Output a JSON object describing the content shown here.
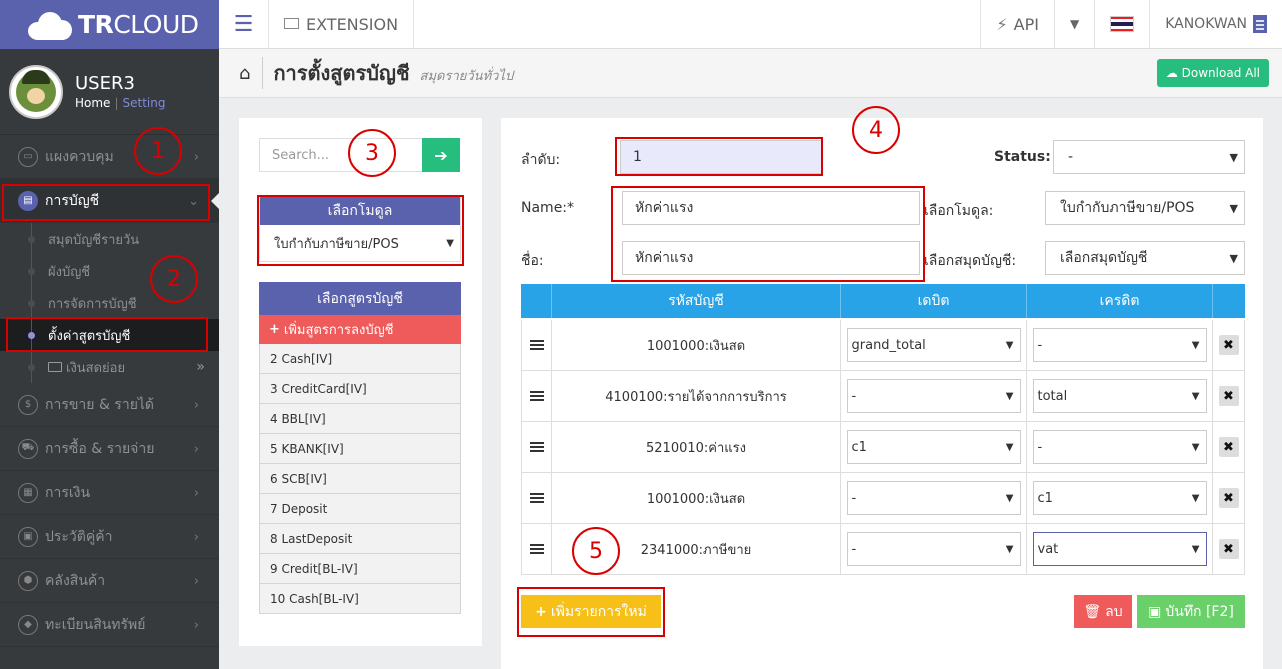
{
  "brand": {
    "tr": "TR",
    "cloud": "CLOUD"
  },
  "user": {
    "name": "USER3",
    "home_link": "Home",
    "separator": "|",
    "setting_link": "Setting"
  },
  "sidebar": {
    "items": [
      {
        "label": "แผงควบคุม",
        "icon": "monitor-icon",
        "glyph": "▭"
      },
      {
        "label": "การบัญชี",
        "icon": "book-icon",
        "glyph": "▤",
        "active": true
      },
      {
        "label": "การขาย & รายได้",
        "icon": "dollar-icon",
        "glyph": "$"
      },
      {
        "label": "การซื้อ & รายจ่าย",
        "icon": "cart-icon",
        "glyph": "⛟"
      },
      {
        "label": "การเงิน",
        "icon": "calendar-icon",
        "glyph": "▦"
      },
      {
        "label": "ประวัติคู่ค้า",
        "icon": "contact-icon",
        "glyph": "▣"
      },
      {
        "label": "คลังสินค้า",
        "icon": "cubes-icon",
        "glyph": "⬢"
      },
      {
        "label": "ทะเบียนสินทรัพย์",
        "icon": "diamond-icon",
        "glyph": "◆"
      }
    ],
    "subitems": [
      {
        "label": "สมุดบัญชีรายวัน"
      },
      {
        "label": "ผังบัญชี"
      },
      {
        "label": "การจัดการบัญชี"
      },
      {
        "label": "ตั้งค่าสูตรบัญชี",
        "active": true
      },
      {
        "label": "เงินสดย่อย"
      }
    ]
  },
  "topbar": {
    "extension_label": "EXTENSION",
    "api_label": "API",
    "username": "KANOKWAN"
  },
  "page": {
    "title": "การตั้งสูตรบัญชี",
    "subtitle": "สมุดรายวันทั่วไป",
    "download_label": "Download All"
  },
  "left_panel": {
    "search_placeholder": "Search...",
    "module_title": "เลือกโมดูล",
    "module_value": "ใบกำกับภาษีขาย/POS",
    "formula_title": "เลือกสูตรบัญชี",
    "add_formula_label": "เพิ่มสูตรการลงบัญชี",
    "formulas": [
      "2 Cash[IV]",
      "3 CreditCard[IV]",
      "4 BBL[IV]",
      "5 KBANK[IV]",
      "6 SCB[IV]",
      "7 Deposit",
      "8 LastDeposit",
      "9 Credit[BL-IV]",
      "10 Cash[BL-IV]"
    ]
  },
  "form": {
    "order_label": "ลำดับ:",
    "order_value": "1",
    "status_label": "Status:",
    "status_value": "-",
    "name_label": "Name:*",
    "name_value": "หักค่าแรง",
    "thai_name_label": "ชื่อ:",
    "thai_name_value": "หักค่าแรง",
    "module_label": "เลือกโมดูล:",
    "module_value": "ใบกำกับภาษีขาย/POS",
    "journal_label": "เลือกสมุดบัญชี:",
    "journal_value": "เลือกสมุดบัญชี"
  },
  "table": {
    "headers": {
      "account": "รหัสบัญชี",
      "debit": "เดบิต",
      "credit": "เครดิต"
    },
    "rows": [
      {
        "account": "1001000:เงินสด",
        "debit": "grand_total",
        "credit": "-"
      },
      {
        "account": "4100100:รายได้จากการบริการ",
        "debit": "-",
        "credit": "total"
      },
      {
        "account": "5210010:ค่าแรง",
        "debit": "c1",
        "credit": "-"
      },
      {
        "account": "1001000:เงินสด",
        "debit": "-",
        "credit": "c1"
      },
      {
        "account": "2341000:ภาษีขาย",
        "debit": "-",
        "credit": "vat"
      }
    ]
  },
  "actions": {
    "add_row_label": "เพิ่มรายการใหม่",
    "delete_label": "ลบ",
    "save_label": "บันทึก [F2]"
  },
  "annotations": [
    "1",
    "2",
    "3",
    "4",
    "5"
  ],
  "colors": {
    "brand": "#5b62ad",
    "green": "#27bd7f",
    "red": "#ef5b5b",
    "blue": "#28a3e7",
    "yellow": "#f6c018",
    "annotation": "#d90000"
  }
}
